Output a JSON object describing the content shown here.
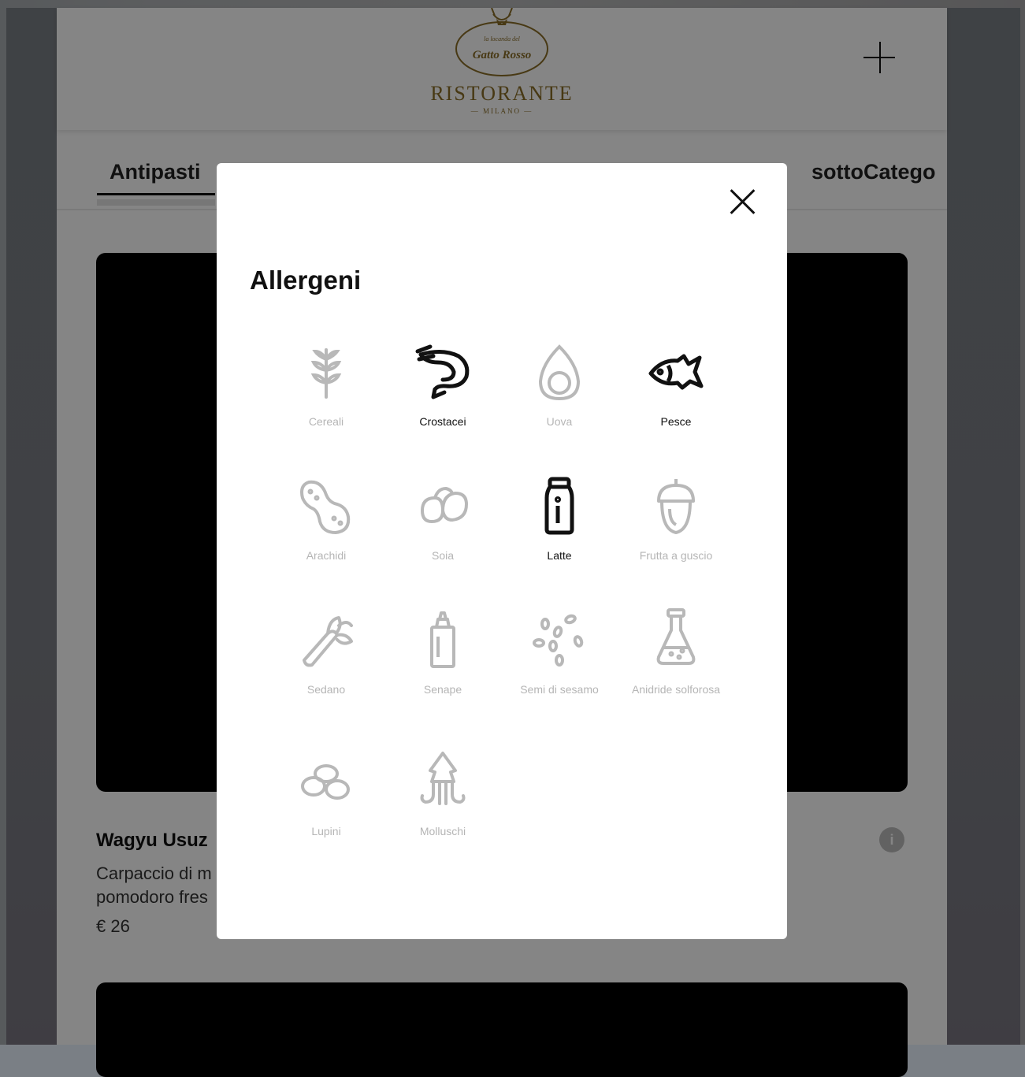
{
  "header": {
    "logo_script_top": "la locanda del",
    "logo_script_name": "Gatto Rosso",
    "logo_word": "RISTORANTE",
    "logo_sub": "— MILANO —"
  },
  "tabs": [
    {
      "label": "Antipasti",
      "active": true
    },
    {
      "label": "sottoCatego",
      "active": false
    }
  ],
  "dish": {
    "name": "Wagyu Usuz",
    "description": "Carpaccio di m pomodoro fres",
    "price": "€ 26"
  },
  "modal": {
    "title": "Allergeni",
    "allergens": [
      {
        "label": "Cereali",
        "icon": "wheat-icon",
        "active": false
      },
      {
        "label": "Crostacei",
        "icon": "shrimp-icon",
        "active": true
      },
      {
        "label": "Uova",
        "icon": "egg-icon",
        "active": false
      },
      {
        "label": "Pesce",
        "icon": "fish-icon",
        "active": true
      },
      {
        "label": "Arachidi",
        "icon": "peanut-icon",
        "active": false
      },
      {
        "label": "Soia",
        "icon": "soy-icon",
        "active": false
      },
      {
        "label": "Latte",
        "icon": "milk-bottle-icon",
        "active": true
      },
      {
        "label": "Frutta a guscio",
        "icon": "acorn-icon",
        "active": false
      },
      {
        "label": "Sedano",
        "icon": "celery-icon",
        "active": false
      },
      {
        "label": "Senape",
        "icon": "mustard-bottle-icon",
        "active": false
      },
      {
        "label": "Semi di sesamo",
        "icon": "sesame-icon",
        "active": false
      },
      {
        "label": "Anidride solforosa",
        "icon": "flask-icon",
        "active": false
      },
      {
        "label": "Lupini",
        "icon": "lupin-icon",
        "active": false
      },
      {
        "label": "Molluschi",
        "icon": "squid-icon",
        "active": false
      }
    ]
  },
  "colors": {
    "logo_gold": "#8a6d28",
    "active_icon": "#111111",
    "inactive_icon": "#b8b8b8"
  }
}
